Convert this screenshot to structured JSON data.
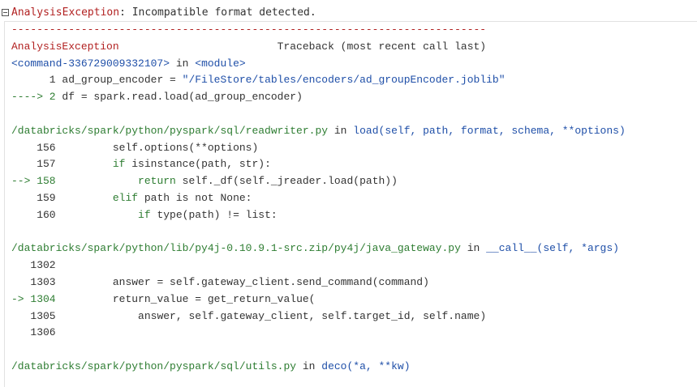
{
  "header": {
    "exception_name": "AnalysisException",
    "exception_message": ": Incompatible format detected."
  },
  "traceback": {
    "separator": "---------------------------------------------------------------------------",
    "title_name": "AnalysisException",
    "title_right": "                         Traceback (most recent call last)",
    "frame1": {
      "location": "<command-336729009332107>",
      "in": " in ",
      "func": "<module>",
      "line1_num": "      1 ",
      "line1_code": "ad_group_encoder = ",
      "line1_str": "\"/FileStore/tables/encoders/ad_groupEncoder.joblib\"",
      "line2_arrow": "----> 2 ",
      "line2_code": "df = spark.read.load(ad_group_encoder)"
    },
    "frame2": {
      "path": "/databricks/spark/python/pyspark/sql/readwriter.py",
      "in": " in ",
      "func": "load",
      "sig": "(self, path, format, schema, **options)",
      "lines": [
        {
          "prefix": "    156 ",
          "indent": "        ",
          "kw": "",
          "code": "self.options(**options)"
        },
        {
          "prefix": "    157 ",
          "indent": "        ",
          "kw": "if",
          "code": " isinstance(path, str):"
        },
        {
          "prefix": "--> 158 ",
          "indent": "            ",
          "kw": "return",
          "code": " self._df(self._jreader.load(path))"
        },
        {
          "prefix": "    159 ",
          "indent": "        ",
          "kw": "elif",
          "code": " path is not None:"
        },
        {
          "prefix": "    160 ",
          "indent": "            ",
          "kw": "if",
          "code": " type(path) != list:"
        }
      ]
    },
    "frame3": {
      "path": "/databricks/spark/python/lib/py4j-0.10.9.1-src.zip/py4j/java_gateway.py",
      "in": " in ",
      "func": "__call__",
      "sig": "(self, *args)",
      "lines": [
        {
          "prefix": "   1302 ",
          "indent": "",
          "kw": "",
          "code": ""
        },
        {
          "prefix": "   1303 ",
          "indent": "        ",
          "kw": "",
          "code": "answer = self.gateway_client.send_command(command)"
        },
        {
          "prefix": "-> 1304 ",
          "indent": "        ",
          "kw": "",
          "code": "return_value = get_return_value("
        },
        {
          "prefix": "   1305 ",
          "indent": "            ",
          "kw": "",
          "code": "answer, self.gateway_client, self.target_id, self.name)"
        },
        {
          "prefix": "   1306 ",
          "indent": "",
          "kw": "",
          "code": ""
        }
      ]
    },
    "frame4": {
      "path": "/databricks/spark/python/pyspark/sql/utils.py",
      "in": " in ",
      "func": "deco",
      "sig": "(*a, **kw)"
    }
  },
  "colors": {
    "exception": "#b22222",
    "path_green": "#2e7d32",
    "func_blue": "#1f4fa8"
  }
}
